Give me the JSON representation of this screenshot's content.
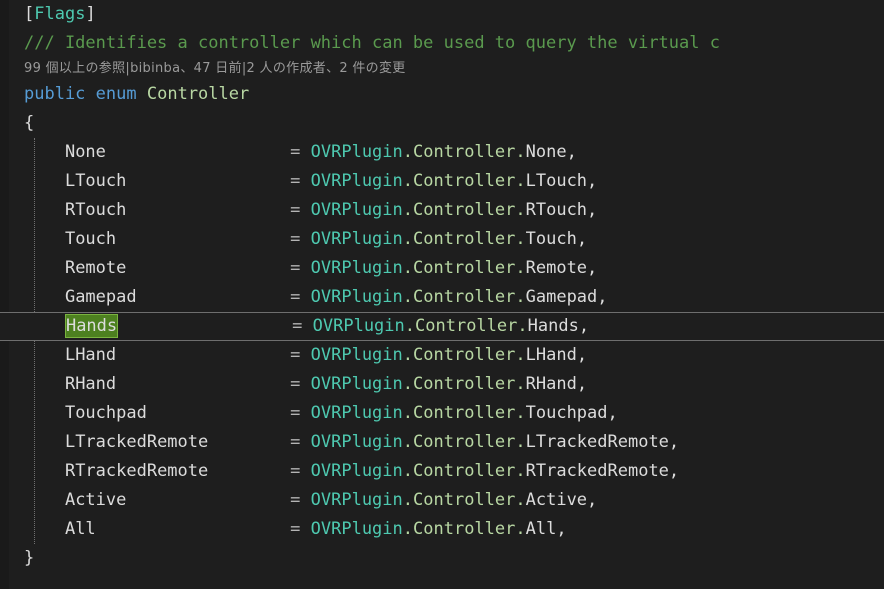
{
  "editor": {
    "background_color": "#1e1e1e",
    "gutter_color": "#1a1a1a",
    "current_line_border_color": "#6e6e6e",
    "highlight_color": "#4d8020",
    "highlight_border_color": "#7ab33f",
    "indent_guide_color": "#707070"
  },
  "colors": {
    "keyword": "#569cd6",
    "type": "#4ec9b0",
    "enum_type": "#b8d7a3",
    "identifier": "#dcdcdc",
    "comment": "#5a9a4e",
    "operator": "#b4b4b4",
    "codelens": "#9a9a9a"
  },
  "attribute": {
    "open_bracket": "[",
    "name": "Flags",
    "close_bracket": "]"
  },
  "doc_comment": {
    "text": "/// Identifies a controller which can be used to query the virtual c"
  },
  "codelens": {
    "references": "99 個以上の参照",
    "sep1": "|",
    "author": "bibinba",
    "sep_comma1": "、",
    "last_change": "47 日前",
    "sep2": "|",
    "authors": "2 人の作成者",
    "sep_comma2": "、",
    "changes": "2 件の変更",
    "full_text": "99 個以上の参照|bibinba、47 日前|2 人の作成者、2 件の変更"
  },
  "declaration": {
    "modifier": "public",
    "keyword": "enum",
    "name": "Controller"
  },
  "braces": {
    "open": "{",
    "close": "}"
  },
  "members": [
    {
      "name": "None",
      "op": "=",
      "qualifier1": "OVRPlugin",
      "qualifier2": "Controller",
      "value": "None",
      "comma": ",",
      "highlighted": false,
      "current": false,
      "truncated": false
    },
    {
      "name": "LTouch",
      "op": "=",
      "qualifier1": "OVRPlugin",
      "qualifier2": "Controller",
      "value": "LTouch",
      "comma": ",",
      "highlighted": false,
      "current": false,
      "truncated": false
    },
    {
      "name": "RTouch",
      "op": "=",
      "qualifier1": "OVRPlugin",
      "qualifier2": "Controller",
      "value": "RTouch",
      "comma": ",",
      "highlighted": false,
      "current": false,
      "truncated": false
    },
    {
      "name": "Touch",
      "op": "=",
      "qualifier1": "OVRPlugin",
      "qualifier2": "Controller",
      "value": "Touch",
      "comma": ",",
      "highlighted": false,
      "current": false,
      "truncated": false
    },
    {
      "name": "Remote",
      "op": "=",
      "qualifier1": "OVRPlugin",
      "qualifier2": "Controller",
      "value": "Remote",
      "comma": ",",
      "highlighted": false,
      "current": false,
      "truncated": false
    },
    {
      "name": "Gamepad",
      "op": "=",
      "qualifier1": "OVRPlugin",
      "qualifier2": "Controller",
      "value": "Gamepad",
      "comma": ",",
      "highlighted": false,
      "current": false,
      "truncated": false
    },
    {
      "name": "Hands",
      "op": "=",
      "qualifier1": "OVRPlugin",
      "qualifier2": "Controller",
      "value": "Hands",
      "comma": ",",
      "highlighted": true,
      "current": true,
      "truncated": false
    },
    {
      "name": "LHand",
      "op": "=",
      "qualifier1": "OVRPlugin",
      "qualifier2": "Controller",
      "value": "LHand",
      "comma": ",",
      "highlighted": false,
      "current": false,
      "truncated": false
    },
    {
      "name": "RHand",
      "op": "=",
      "qualifier1": "OVRPlugin",
      "qualifier2": "Controller",
      "value": "RHand",
      "comma": ",",
      "highlighted": false,
      "current": false,
      "truncated": false
    },
    {
      "name": "Touchpad",
      "op": "=",
      "qualifier1": "OVRPlugin",
      "qualifier2": "Controller",
      "value": "Touchpad",
      "comma": ",",
      "highlighted": false,
      "current": false,
      "truncated": false
    },
    {
      "name": "LTrackedRemote",
      "op": "=",
      "qualifier1": "OVRPlugin",
      "qualifier2": "Controller",
      "value": "LTrackedRemote",
      "comma": ",",
      "highlighted": false,
      "current": false,
      "truncated": true
    },
    {
      "name": "RTrackedRemote",
      "op": "=",
      "qualifier1": "OVRPlugin",
      "qualifier2": "Controller",
      "value": "RTrackedRemote",
      "comma": ",",
      "highlighted": false,
      "current": false,
      "truncated": true
    },
    {
      "name": "Active",
      "op": "=",
      "qualifier1": "OVRPlugin",
      "qualifier2": "Controller",
      "value": "Active",
      "comma": ",",
      "highlighted": false,
      "current": false,
      "truncated": false
    },
    {
      "name": "All",
      "op": "=",
      "qualifier1": "OVRPlugin",
      "qualifier2": "Controller",
      "value": "All",
      "comma": ",",
      "highlighted": false,
      "current": false,
      "truncated": false
    }
  ]
}
